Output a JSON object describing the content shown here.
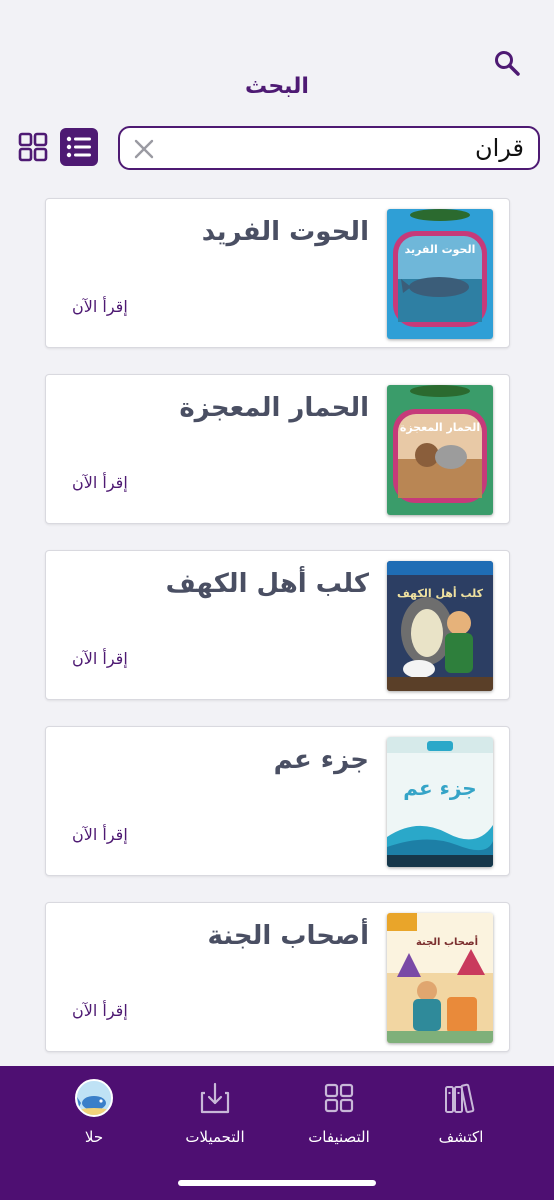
{
  "header": {
    "title": "البحث",
    "search_icon": "search-icon"
  },
  "search": {
    "value": "قران",
    "clear_icon": "close-icon"
  },
  "view_toggle": {
    "grid_icon": "grid-view-icon",
    "list_icon": "list-view-icon",
    "active": "list"
  },
  "results": [
    {
      "title": "الحوت الفريد",
      "action": "إقرأ الآن",
      "cover_text": "الحوت الفريد"
    },
    {
      "title": "الحمار المعجزة",
      "action": "إقرأ الآن",
      "cover_text": "الحمار المعجزة"
    },
    {
      "title": "كلب أهل الكهف",
      "action": "إقرأ الآن",
      "cover_text": "كلب أهل الكهف"
    },
    {
      "title": "جزء عم",
      "action": "إقرأ الآن",
      "cover_text": "جزء عم"
    },
    {
      "title": "أصحاب الجنة",
      "action": "إقرأ الآن",
      "cover_text": "أصحاب الجنة"
    }
  ],
  "tabbar": {
    "explore": "اكتشف",
    "categories": "التصنيفات",
    "downloads": "التحميلات",
    "profile": "حلا"
  },
  "colors": {
    "brand": "#4e1a73",
    "tabbar": "#4e0f72",
    "title_text": "#4a4f63",
    "background": "#f2f2f6"
  }
}
